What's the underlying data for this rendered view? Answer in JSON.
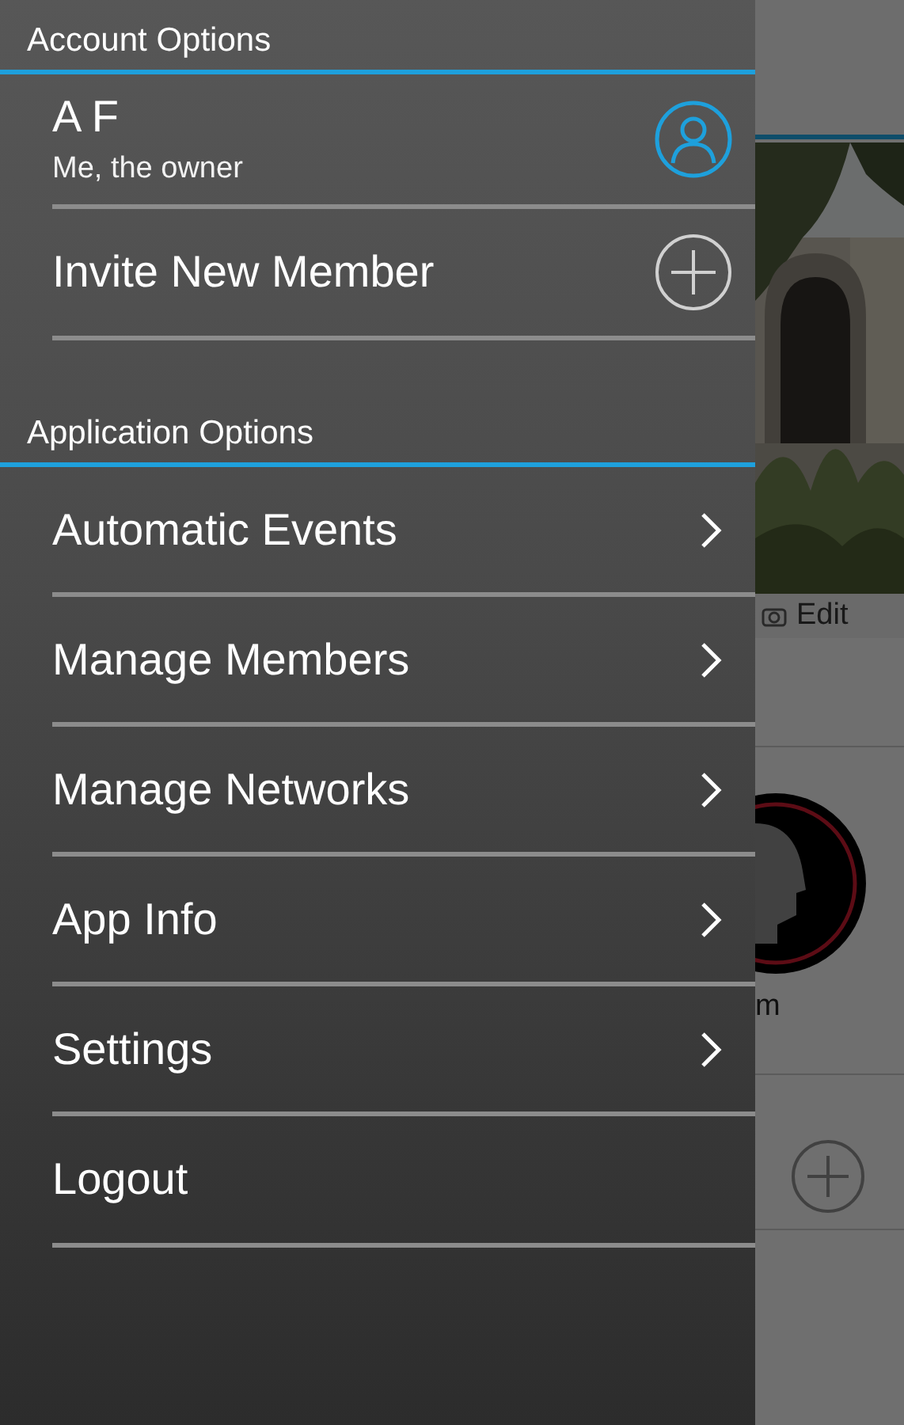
{
  "drawer": {
    "sections": [
      {
        "title": "Account Options",
        "items": [
          {
            "kind": "account",
            "label": "A F",
            "subtitle": "Me, the owner"
          },
          {
            "kind": "add",
            "label": "Invite New Member"
          }
        ]
      },
      {
        "title": "Application Options",
        "items": [
          {
            "kind": "link",
            "label": "Automatic Events"
          },
          {
            "kind": "link",
            "label": "Manage Members"
          },
          {
            "kind": "link",
            "label": "Manage Networks"
          },
          {
            "kind": "link",
            "label": "App Info"
          },
          {
            "kind": "link",
            "label": "Settings"
          },
          {
            "kind": "plain",
            "label": "Logout"
          }
        ]
      }
    ]
  },
  "background": {
    "edit_label": "Edit",
    "tile_caption": "m"
  }
}
